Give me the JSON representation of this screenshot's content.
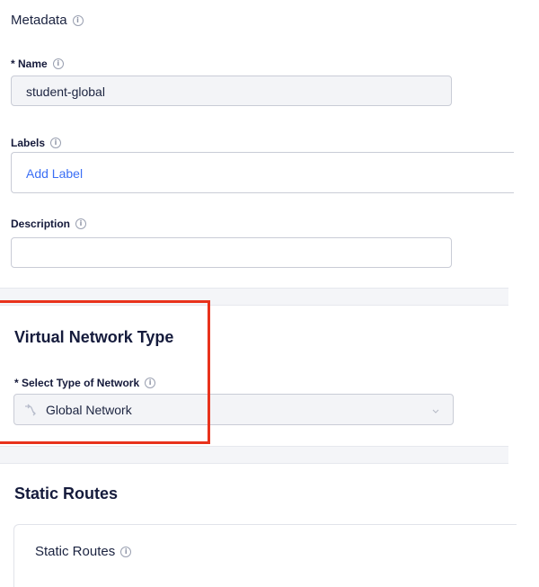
{
  "metadata": {
    "title": "Metadata",
    "info_icon": "info-icon",
    "name_label": "* Name",
    "name_value": "student-global",
    "labels_label": "Labels",
    "add_label": "Add Label",
    "description_label": "Description",
    "description_value": ""
  },
  "virtual_network": {
    "title": "Virtual Network Type",
    "select_label": "* Select Type of Network",
    "selected_value": "Global Network",
    "selected_icon": "network-type-icon",
    "dropdown_icon": "chevron-down-icon"
  },
  "static_routes": {
    "title": "Static Routes",
    "card_title": "Static Routes"
  },
  "colors": {
    "highlight_box": "#e8321c",
    "link": "#3b6ff5",
    "input_filled_bg": "#f3f4f7"
  }
}
